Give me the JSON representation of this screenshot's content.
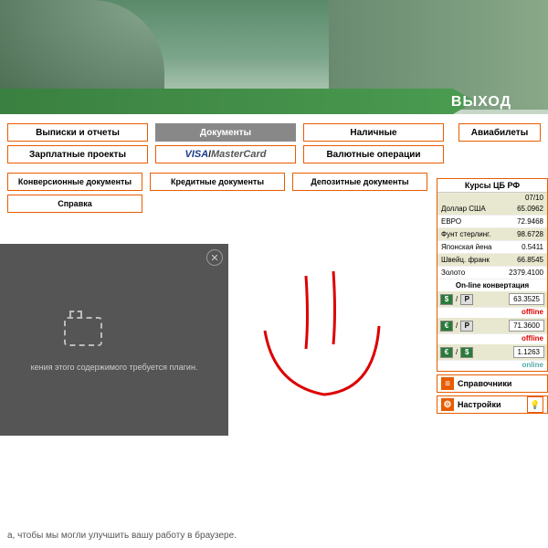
{
  "header": {
    "exit_label": "ВЫХОД"
  },
  "nav": {
    "row1": [
      "Выписки и отчеты",
      "Документы",
      "Наличные"
    ],
    "row1_right": "Авиабилеты",
    "row2": [
      "Зарплатные проекты",
      "",
      "Валютные операции"
    ],
    "visa_text": "VISA",
    "visa_sep": " / ",
    "mc_text": "MasterCard"
  },
  "subnav": {
    "row1": [
      "Конверсионные документы",
      "Кредитные документы",
      "Депозитные документы"
    ],
    "row2": [
      "Справка"
    ]
  },
  "plugin": {
    "message": "кения этого содержимого требуется плагин."
  },
  "rates": {
    "title": "Курсы ЦБ РФ",
    "date": "07/10",
    "items": [
      {
        "name": "Доллар США",
        "value": "65.0962"
      },
      {
        "name": "ЕВРО",
        "value": "72.9468"
      },
      {
        "name": "Фунт стерлинг.",
        "value": "98.6728"
      },
      {
        "name": "Японская йена",
        "value": "0.5411"
      },
      {
        "name": "Швейц. франк",
        "value": "66.8545"
      },
      {
        "name": "Золото",
        "value": "2379.4100"
      }
    ]
  },
  "online": {
    "title": "On-line конвертация",
    "rows": [
      {
        "from": "$",
        "to": "Р",
        "value": "63.3525",
        "status": "offline",
        "status_class": "off"
      },
      {
        "from": "€",
        "to": "Р",
        "value": "71.3600",
        "status": "offline",
        "status_class": "off"
      },
      {
        "from": "€",
        "to": "$",
        "value": "1.1263",
        "status": "online",
        "status_class": "on"
      }
    ]
  },
  "sidebar_buttons": {
    "ref": "Справочники",
    "settings": "Настройки"
  },
  "footer": "а, чтобы мы могли улучшить вашу работу в браузере."
}
